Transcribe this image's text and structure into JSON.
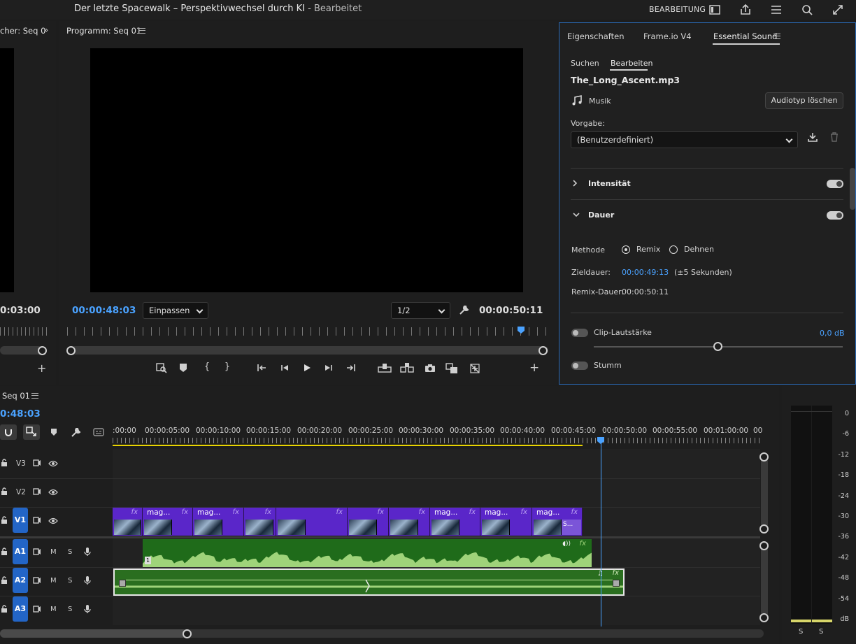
{
  "titlebar": {
    "title": "Der letzte Spacewalk – Perspektivwechsel durch KI",
    "status": "- Bearbeitet",
    "workspace": "BEARBEITUNG"
  },
  "source_panel": {
    "title": "cher: Seq 0",
    "timecode": "0:03:00"
  },
  "program": {
    "title": "Programm: Seq 01",
    "timecode_current": "00:00:48:03",
    "fit": "Einpassen",
    "resolution": "1/2",
    "timecode_duration": "00:00:50:11"
  },
  "essential_sound": {
    "tabs": [
      "Eigenschaften",
      "Frame.io V4",
      "Essential Sound"
    ],
    "subtabs": [
      "Suchen",
      "Bearbeiten"
    ],
    "file_name": "The_Long_Ascent.mp3",
    "audio_type": "Musik",
    "clear_button": "Audiotyp löschen",
    "preset_label": "Vorgabe:",
    "preset_value": "(Benutzerdefiniert)",
    "section_intensity": "Intensität",
    "section_duration": "Dauer",
    "method_label": "Methode",
    "method_remix": "Remix",
    "method_stretch": "Dehnen",
    "target_label": "Zieldauer:",
    "target_value": "00:00:49:13",
    "target_note": "(±5 Sekunden)",
    "remix_label": "Remix-Dauer:",
    "remix_value": "00:00:50:11",
    "clip_volume_label": "Clip-Lautstärke",
    "clip_volume_value": "0,0 dB",
    "mute_label": "Stumm"
  },
  "timeline": {
    "title": "Seq 01",
    "timecode": "0:48:03",
    "ruler": [
      ":00:00",
      "00:00:05:00",
      "00:00:10:00",
      "00:00:15:00",
      "00:00:20:00",
      "00:00:25:00",
      "00:00:30:00",
      "00:00:35:00",
      "00:00:40:00",
      "00:00:45:00",
      "00:00:50:00",
      "00:00:55:00",
      "00:01:00:00",
      "00"
    ],
    "tracks": {
      "v3": "V3",
      "v2": "V2",
      "v1": "V1",
      "a1": "A1",
      "a2": "A2",
      "a3": "A3",
      "m": "M",
      "s": "S"
    },
    "clip_name": "mag...",
    "clip_fx": "fx",
    "last_clip_name": "S..."
  },
  "meter": {
    "scale": [
      "0",
      "-6",
      "-12",
      "-18",
      "-24",
      "-30",
      "-36",
      "-42",
      "-48",
      "-54",
      "dB"
    ],
    "channels": [
      "S",
      "S"
    ]
  }
}
